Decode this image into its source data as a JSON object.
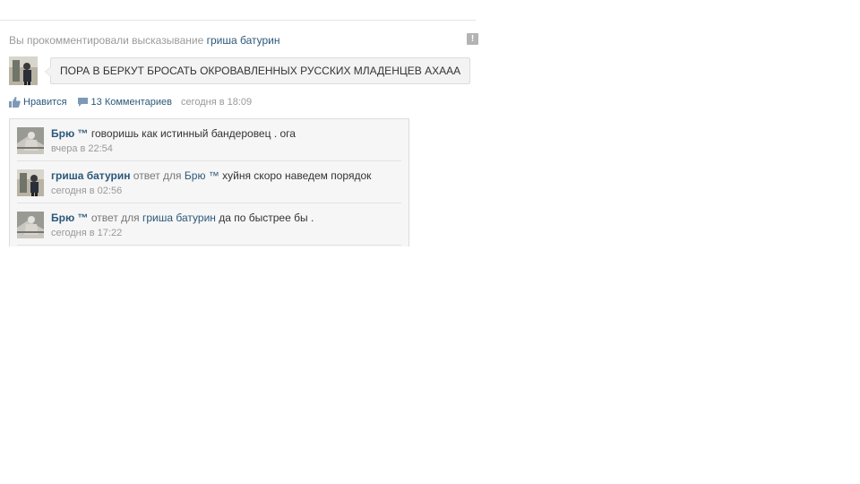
{
  "header": {
    "prefix": "Вы прокомментировали высказывание",
    "target_user": "гриша батурин",
    "report_icon": "exclamation-icon"
  },
  "status": {
    "text": "ПОРА В БЕРКУТ БРОСАТЬ ОКРОВАВЛЕННЫХ РУССКИХ МЛАДЕНЦЕВ АХААА"
  },
  "actions": {
    "like_label": "Нравится",
    "comments_label": "13 Комментариев",
    "time": "сегодня в 18:09"
  },
  "comments": [
    {
      "author": "Брю ™",
      "reply_prefix": "",
      "reply_to": "",
      "text": "говоришь как истинный бандеровец . ога",
      "time": "вчера в 22:54",
      "avatar": "statue-avatar"
    },
    {
      "author": "гриша батурин",
      "reply_prefix": "ответ для",
      "reply_to": "Брю ™",
      "text": "хуйня скоро наведем порядок",
      "time": "сегодня в 02:56",
      "avatar": "person-avatar"
    },
    {
      "author": "Брю ™",
      "reply_prefix": "ответ для",
      "reply_to": "гриша батурин",
      "text": "да по быстрее бы .",
      "time": "сегодня в 17:22",
      "avatar": "statue-avatar"
    }
  ],
  "colors": {
    "link": "#2b587a",
    "muted": "#999999",
    "bubble_bg": "#f3f3f3",
    "comments_bg": "#f6f6f6"
  }
}
